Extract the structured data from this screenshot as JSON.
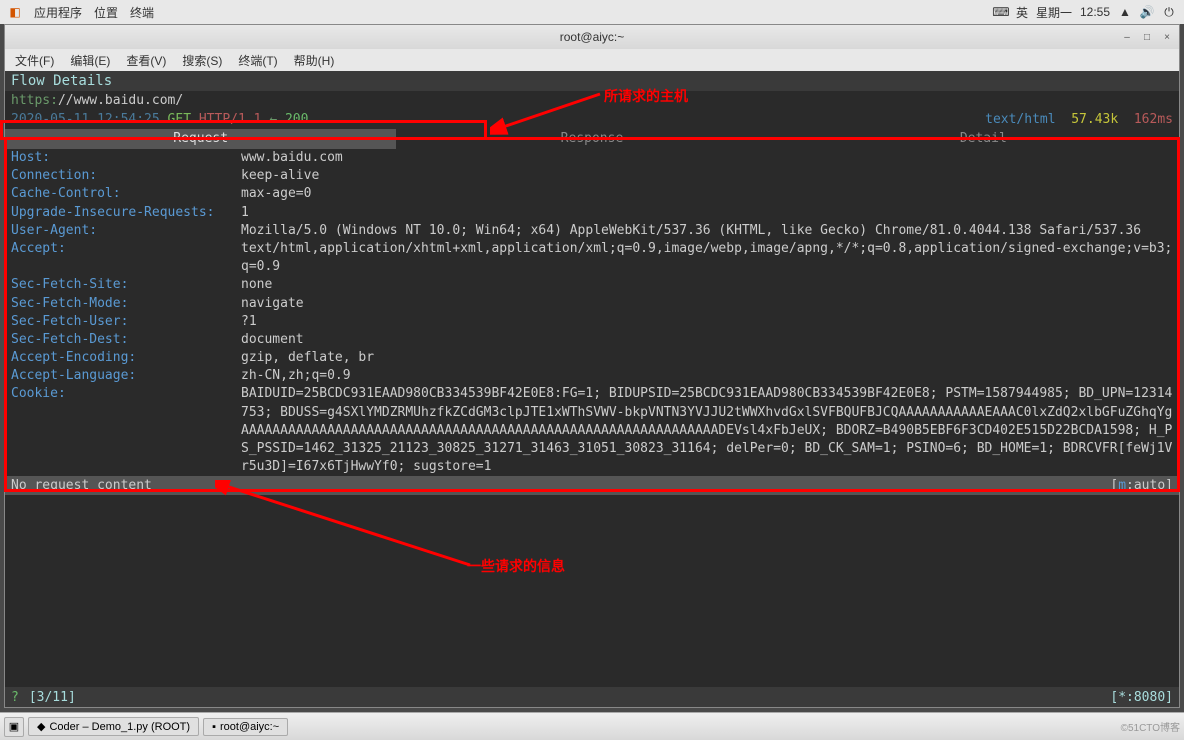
{
  "gnome": {
    "apps": "应用程序",
    "places": "位置",
    "terminal": "终端",
    "lang": "英",
    "day": "星期一",
    "time": "12:55"
  },
  "window": {
    "title": "root@aiyc:~"
  },
  "menu": {
    "file": "文件(F)",
    "edit": "编辑(E)",
    "view": "查看(V)",
    "search": "搜索(S)",
    "terminal": "终端(T)",
    "help": "帮助(H)"
  },
  "flow": {
    "header": "Flow Details",
    "url_scheme": "https:",
    "url_rest": "//www.baidu.com/",
    "timestamp": "2020-05-11 12:54:25",
    "method": "GET",
    "proto": "HTTP/1.1",
    "arrow": "←",
    "code": "200",
    "content_type": "text/html",
    "size": "57.43k",
    "time": "162ms",
    "tabs": {
      "request": "Request",
      "response": "Response",
      "detail": "Detail"
    }
  },
  "headers": [
    {
      "key": "Host:",
      "val": "www.baidu.com"
    },
    {
      "key": "Connection:",
      "val": "keep-alive"
    },
    {
      "key": "Cache-Control:",
      "val": "max-age=0"
    },
    {
      "key": "Upgrade-Insecure-Requests:",
      "val": "1"
    },
    {
      "key": "User-Agent:",
      "val": "Mozilla/5.0 (Windows NT 10.0; Win64; x64) AppleWebKit/537.36 (KHTML, like Gecko) Chrome/81.0.4044.138 Safari/537.36"
    },
    {
      "key": "Accept:",
      "val": "text/html,application/xhtml+xml,application/xml;q=0.9,image/webp,image/apng,*/*;q=0.8,application/signed-exchange;v=b3;q=0.9"
    },
    {
      "key": "Sec-Fetch-Site:",
      "val": "none"
    },
    {
      "key": "Sec-Fetch-Mode:",
      "val": "navigate"
    },
    {
      "key": "Sec-Fetch-User:",
      "val": "?1"
    },
    {
      "key": "Sec-Fetch-Dest:",
      "val": "document"
    },
    {
      "key": "Accept-Encoding:",
      "val": "gzip, deflate, br"
    },
    {
      "key": "Accept-Language:",
      "val": "zh-CN,zh;q=0.9"
    },
    {
      "key": "Cookie:",
      "val": "BAIDUID=25BCDC931EAAD980CB334539BF42E0E8:FG=1; BIDUPSID=25BCDC931EAAD980CB334539BF42E0E8; PSTM=1587944985; BD_UPN=12314753; BDUSS=g4SXlYMDZRMUhzfkZCdGM3clpJTE1xWThSVWV-bkpVNTN3YVJJU2tWWXhvdGxlSVFBQUFBJCQAAAAAAAAAAAEAAAC0lxZdQ2xlbGFuZGhqYgAAAAAAAAAAAAAAAAAAAAAAAAAAAAAAAAAAAAAAAAAAAAAAAAAAAAAAAAAAAAADEVsl4xFbJeUX; BDORZ=B490B5EBF6F3CD402E515D22BCDA1598; H_PS_PSSID=1462_31325_21123_30825_31271_31463_31051_30823_31164; delPer=0; BD_CK_SAM=1; PSINO=6; BD_HOME=1; BDRCVFR[feWj1Vr5u3D]=I67x6TjHwwYf0; sugstore=1"
    }
  ],
  "no_content": {
    "text": "No request content",
    "mode_label": "m",
    "mode_value": ":auto"
  },
  "status_bar": {
    "pos": "[3/11]",
    "port": "[*:8080]"
  },
  "taskbar": {
    "item1": "Coder – Demo_1.py (ROOT)",
    "item2": "root@aiyc:~"
  },
  "annotations": {
    "label1": "所请求的主机",
    "label2": "一些请求的信息"
  }
}
